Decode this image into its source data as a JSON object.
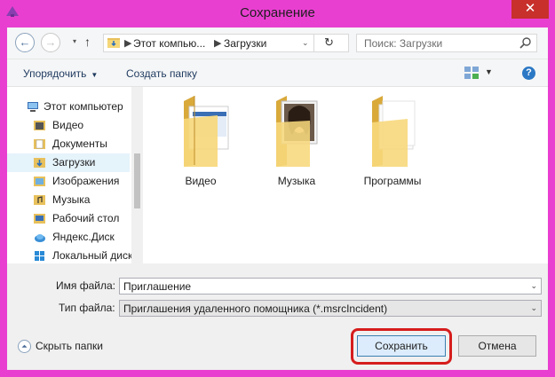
{
  "window": {
    "title": "Сохранение",
    "close_glyph": "✕"
  },
  "nav": {
    "back_glyph": "←",
    "forward_glyph": "→",
    "up_glyph": "↑",
    "breadcrumb": [
      "Этот компью...",
      "Загрузки"
    ],
    "breadcrumb_sep": "▶",
    "address_dropdown": "⌄",
    "refresh_glyph": "↻",
    "search_placeholder": "Поиск: Загрузки"
  },
  "toolbar": {
    "organize": "Упорядочить",
    "organize_arrow": "▼",
    "new_folder": "Создать папку",
    "view_arrow": "▼",
    "help": "?"
  },
  "sidebar": {
    "items": [
      {
        "label": "Этот компьютер",
        "icon": "computer-icon"
      },
      {
        "label": "Видео",
        "icon": "video-folder-icon"
      },
      {
        "label": "Документы",
        "icon": "documents-folder-icon"
      },
      {
        "label": "Загрузки",
        "icon": "downloads-folder-icon",
        "selected": true
      },
      {
        "label": "Изображения",
        "icon": "pictures-folder-icon"
      },
      {
        "label": "Музыка",
        "icon": "music-folder-icon"
      },
      {
        "label": "Рабочий стол",
        "icon": "desktop-folder-icon"
      },
      {
        "label": "Яндекс.Диск",
        "icon": "yandex-disk-icon"
      },
      {
        "label": "Локальный диск",
        "icon": "windows-drive-icon"
      }
    ]
  },
  "files": [
    {
      "label": "Видео",
      "icon": "video-folder-icon"
    },
    {
      "label": "Музыка",
      "icon": "music-folder-icon"
    },
    {
      "label": "Программы",
      "icon": "programs-folder-icon"
    }
  ],
  "form": {
    "filename_label": "Имя файла:",
    "filename_value": "Приглашение",
    "filetype_label": "Тип файла:",
    "filetype_value": "Приглашения удаленного помощника (*.msrcIncident)",
    "chevron": "⌄"
  },
  "footer": {
    "hide_folders": "Скрыть папки",
    "save": "Сохранить",
    "cancel": "Отмена"
  },
  "colors": {
    "title_bar": "#e93fd1",
    "close_button": "#c7302b",
    "highlight": "#d61d1d",
    "selection": "#e5f3fb"
  }
}
